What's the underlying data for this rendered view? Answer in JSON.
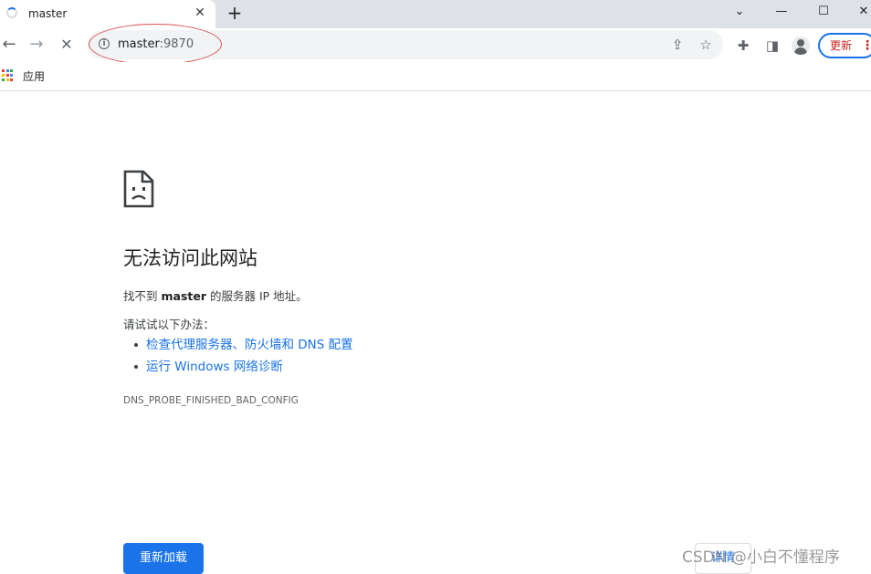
{
  "tab": {
    "title": "master",
    "close": "✕",
    "new_tab": "+"
  },
  "window_controls": {
    "tab_search": "⌄",
    "minimize": "—",
    "maximize": "☐",
    "close": "✕"
  },
  "toolbar": {
    "back": "←",
    "forward": "→",
    "stop": "✕",
    "url_host": "master",
    "url_port": ":9870",
    "info": "i",
    "share": "⇪",
    "star": "☆",
    "extensions": "✚",
    "sidepanel": "◨",
    "update_label": "更新",
    "menu": "⋮"
  },
  "bookmarks": {
    "apps_label": "应用",
    "apps_colors": [
      "#ea4335",
      "#4285f4",
      "#34a853",
      "#fbbc05",
      "#ea4335",
      "#4285f4",
      "#34a853",
      "#fbbc05",
      "#ea4335"
    ]
  },
  "error": {
    "title": "无法访问此网站",
    "desc_prefix": "找不到 ",
    "desc_host": "master",
    "desc_suffix": " 的服务器 IP 地址。",
    "try_label": "请试试以下办法：",
    "suggestions": [
      "检查代理服务器、防火墙和 DNS 配置",
      "运行 Windows 网络诊断"
    ],
    "code": "DNS_PROBE_FINISHED_BAD_CONFIG",
    "reload_label": "重新加载",
    "details_label": "详情"
  },
  "watermark": "CSDN @小白不懂程序",
  "colors": {
    "accent": "#1a73e8",
    "annotation": "#d9534f",
    "update_text": "#c5221f"
  }
}
